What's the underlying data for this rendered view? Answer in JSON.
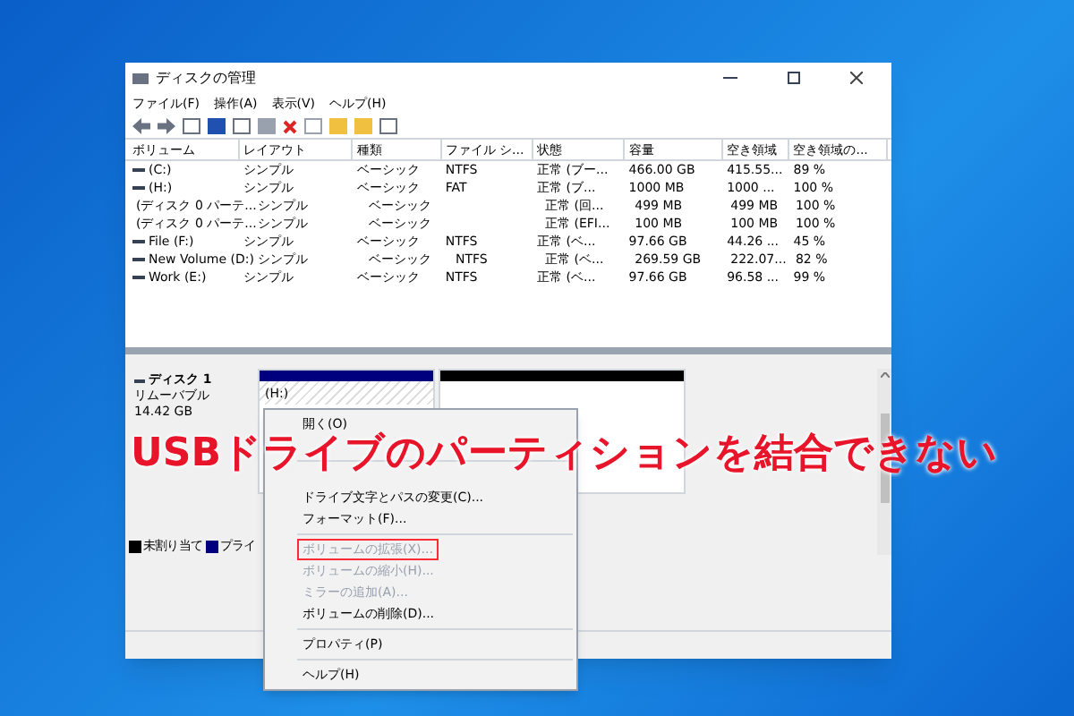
{
  "window": {
    "title": "ディスクの管理"
  },
  "menu": [
    "ファイル(F)",
    "操作(A)",
    "表示(V)",
    "ヘルプ(H)"
  ],
  "table": {
    "columns": [
      "ボリューム",
      "レイアウト",
      "種類",
      "ファイル シ...",
      "状態",
      "容量",
      "空き領域",
      "空き領域の..."
    ],
    "rows": [
      [
        "(C:)",
        "シンプル",
        "ベーシック",
        "NTFS",
        "正常 (ブー...",
        "466.00 GB",
        "415.55...",
        "89 %"
      ],
      [
        "(H:)",
        "シンプル",
        "ベーシック",
        "FAT",
        "正常 (ブ...",
        "1000 MB",
        "1000 ...",
        "100 %"
      ],
      [
        "(ディスク 0 パーテ...",
        "シンプル",
        "ベーシック",
        "",
        "正常 (回...",
        "499 MB",
        "499 MB",
        "100 %"
      ],
      [
        "(ディスク 0 パーテ...",
        "シンプル",
        "ベーシック",
        "",
        "正常 (EFI...",
        "100 MB",
        "100 MB",
        "100 %"
      ],
      [
        "File (F:)",
        "シンプル",
        "ベーシック",
        "NTFS",
        "正常 (ベ...",
        "97.66 GB",
        "44.26 ...",
        "45 %"
      ],
      [
        "New Volume (D:)",
        "シンプル",
        "ベーシック",
        "NTFS",
        "正常 (ベ...",
        "269.59 GB",
        "222.07...",
        "82 %"
      ],
      [
        "Work (E:)",
        "シンプル",
        "ベーシック",
        "NTFS",
        "正常 (ベ...",
        "97.66 GB",
        "96.58 ...",
        "99 %"
      ]
    ]
  },
  "disk": {
    "name": "ディスク 1",
    "type": "リムーバブル",
    "size": "14.42 GB",
    "partitions": [
      {
        "label": "(H:)",
        "color": "#00007f"
      },
      {
        "color": "#000000"
      }
    ]
  },
  "legend": [
    {
      "label": "未割り当て",
      "color": "#000000"
    },
    {
      "label": "プライ",
      "color": "#00007f"
    }
  ],
  "context_menu": [
    {
      "kind": "item",
      "label": "開く(O)",
      "disabled": false,
      "highlighted": false
    },
    {
      "kind": "obscured"
    },
    {
      "kind": "separator"
    },
    {
      "kind": "obscured"
    },
    {
      "kind": "item",
      "label": "ドライブ文字とパスの変更(C)...",
      "disabled": false,
      "highlighted": false
    },
    {
      "kind": "item",
      "label": "フォーマット(F)...",
      "disabled": false,
      "highlighted": false
    },
    {
      "kind": "separator"
    },
    {
      "kind": "item",
      "label": "ボリュームの拡張(X)...",
      "disabled": true,
      "highlighted": true
    },
    {
      "kind": "item",
      "label": "ボリュームの縮小(H)...",
      "disabled": true,
      "highlighted": false
    },
    {
      "kind": "item",
      "label": "ミラーの追加(A)...",
      "disabled": true,
      "highlighted": false
    },
    {
      "kind": "item",
      "label": "ボリュームの削除(D)...",
      "disabled": false,
      "highlighted": false
    },
    {
      "kind": "separator"
    },
    {
      "kind": "item",
      "label": "プロパティ(P)",
      "disabled": false,
      "highlighted": false
    },
    {
      "kind": "separator"
    },
    {
      "kind": "item",
      "label": "ヘルプ(H)",
      "disabled": false,
      "highlighted": false
    }
  ],
  "banner": "USBドライブのパーティションを結合できない"
}
